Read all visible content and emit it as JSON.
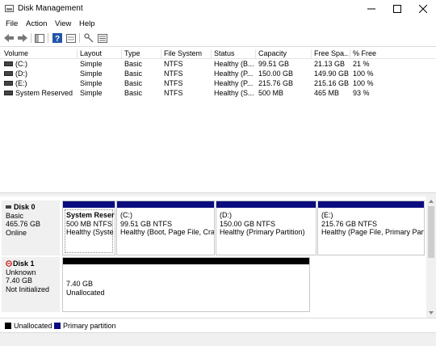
{
  "window": {
    "title": "Disk Management",
    "controls": {
      "minimize": "—",
      "maximize": "☐",
      "close": "✕"
    }
  },
  "menu": {
    "file": "File",
    "action": "Action",
    "view": "View",
    "help": "Help"
  },
  "toolbar": {
    "icons": [
      "back-icon",
      "forward-icon",
      "console-tree-icon",
      "help-icon",
      "properties-icon",
      "key-icon",
      "list-view-icon"
    ]
  },
  "volume_table": {
    "columns": [
      "Volume",
      "Layout",
      "Type",
      "File System",
      "Status",
      "Capacity",
      "Free Spa...",
      "% Free"
    ],
    "rows": [
      {
        "volume": "(C:)",
        "layout": "Simple",
        "type": "Basic",
        "fs": "NTFS",
        "status": "Healthy (B...",
        "capacity": "99.51 GB",
        "free": "21.13 GB",
        "pct": "21 %"
      },
      {
        "volume": "(D:)",
        "layout": "Simple",
        "type": "Basic",
        "fs": "NTFS",
        "status": "Healthy (P...",
        "capacity": "150.00 GB",
        "free": "149.90 GB",
        "pct": "100 %"
      },
      {
        "volume": "(E:)",
        "layout": "Simple",
        "type": "Basic",
        "fs": "NTFS",
        "status": "Healthy (P...",
        "capacity": "215.76 GB",
        "free": "215.16 GB",
        "pct": "100 %"
      },
      {
        "volume": "System Reserved",
        "layout": "Simple",
        "type": "Basic",
        "fs": "NTFS",
        "status": "Healthy (S...",
        "capacity": "500 MB",
        "free": "465 MB",
        "pct": "93 %"
      }
    ]
  },
  "disks": [
    {
      "name": "Disk 0",
      "type": "Basic",
      "size": "465.76 GB",
      "state": "Online",
      "partitions": [
        {
          "name": "System Reser",
          "size": "500 MB NTFS",
          "status": "Healthy (Syste"
        },
        {
          "name": "(C:)",
          "size": "99.51 GB NTFS",
          "status": "Healthy (Boot, Page File, Cras"
        },
        {
          "name": "(D:)",
          "size": "150.00 GB NTFS",
          "status": "Healthy (Primary Partition)"
        },
        {
          "name": "(E:)",
          "size": "215.76 GB NTFS",
          "status": "Healthy (Page File, Primary Parti"
        }
      ]
    },
    {
      "name": "Disk 1",
      "type": "Unknown",
      "size": "7.40 GB",
      "state": "Not Initialized",
      "partitions": [
        {
          "name": "",
          "size": "7.40 GB",
          "status": "Unallocated"
        }
      ]
    }
  ],
  "legend": {
    "unallocated": "Unallocated",
    "primary": "Primary partition"
  },
  "colors": {
    "primary": "#0a0c80",
    "unallocated": "#000000",
    "error_marker": "#c00000"
  }
}
